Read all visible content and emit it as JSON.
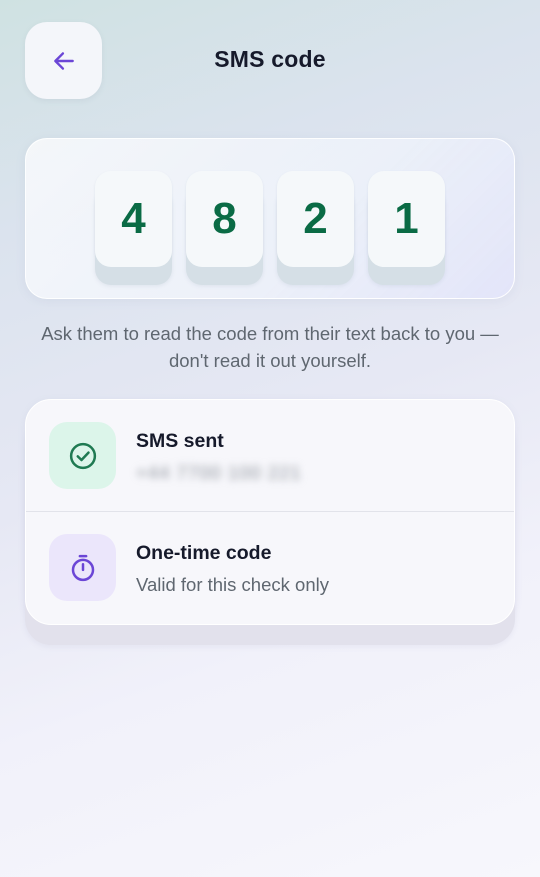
{
  "header": {
    "title": "SMS code",
    "back_icon": "arrow-left-icon"
  },
  "code": {
    "digits": [
      "4",
      "8",
      "2",
      "1"
    ]
  },
  "hint": "Ask them to read the code from their text back to you — don't read it out yourself.",
  "status": {
    "sms_sent": {
      "title": "SMS sent",
      "subtitle": "+44 7700 100 221",
      "icon": "check-circle-icon"
    },
    "one_time_code": {
      "title": "One-time code",
      "subtitle": "Valid for this check only",
      "icon": "stopwatch-icon"
    }
  },
  "colors": {
    "accent_purple": "#6b46d6",
    "digit_green": "#0a6b45",
    "check_green": "#1f7a52",
    "title_dark": "#161a2b"
  }
}
